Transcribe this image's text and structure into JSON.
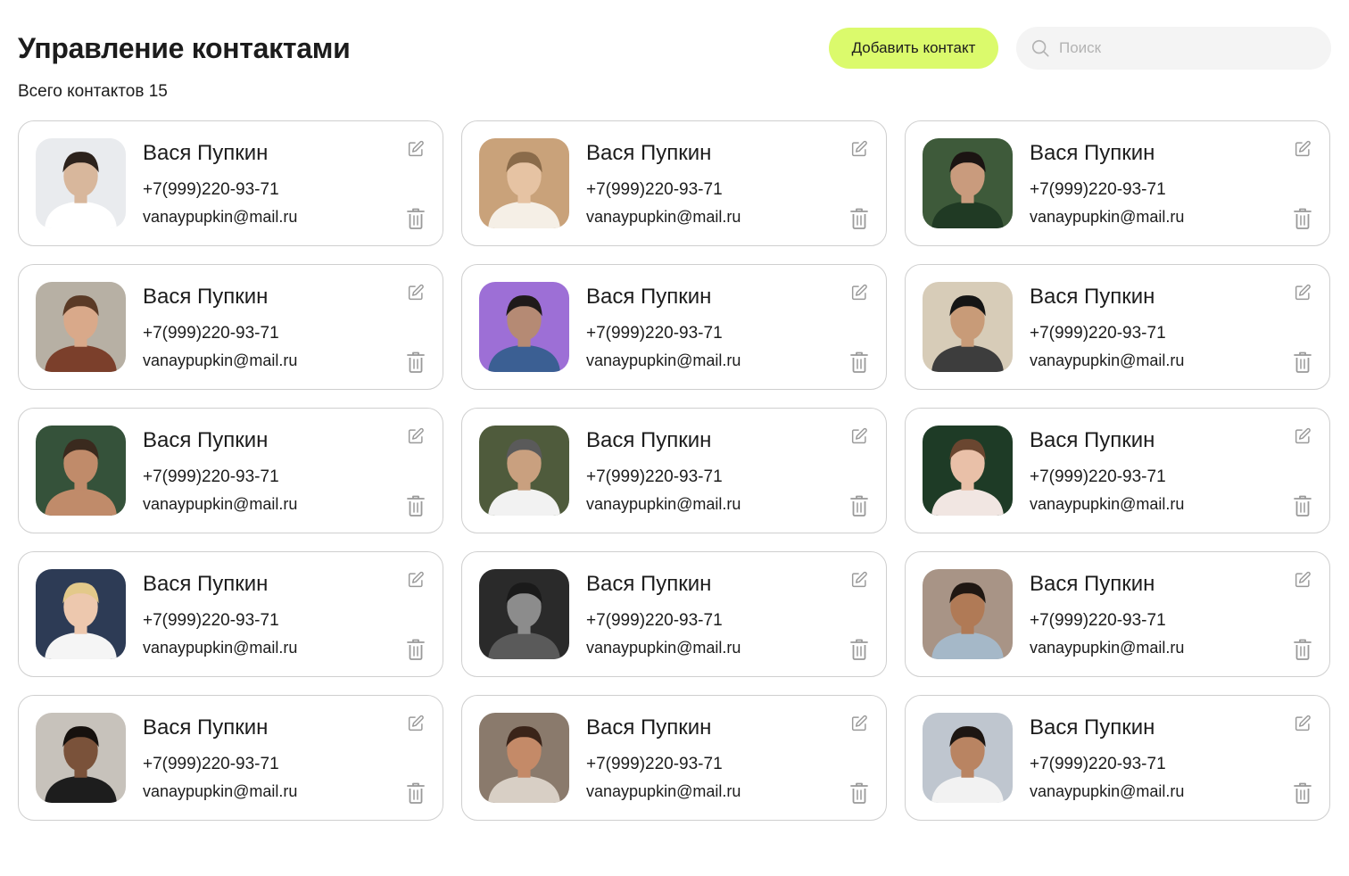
{
  "header": {
    "title": "Управление контактами",
    "add_button_label": "Добавить контакт",
    "search_placeholder": "Поиск",
    "search_value": ""
  },
  "summary": {
    "count_label": "Всего контактов",
    "count": "15"
  },
  "colors": {
    "accent": "#dbfa6c",
    "card_border": "#cfcfcf",
    "search_bg": "#f4f4f4",
    "icon": "#9a9a9a"
  },
  "icons": {
    "search": "search-icon",
    "edit": "edit-icon",
    "delete": "trash-icon"
  },
  "contacts": [
    {
      "name": "Вася Пупкин",
      "phone": "+7(999)220-93-71",
      "email": "vanaypupkin@mail.ru"
    },
    {
      "name": "Вася Пупкин",
      "phone": "+7(999)220-93-71",
      "email": "vanaypupkin@mail.ru"
    },
    {
      "name": "Вася Пупкин",
      "phone": "+7(999)220-93-71",
      "email": "vanaypupkin@mail.ru"
    },
    {
      "name": "Вася Пупкин",
      "phone": "+7(999)220-93-71",
      "email": "vanaypupkin@mail.ru"
    },
    {
      "name": "Вася Пупкин",
      "phone": "+7(999)220-93-71",
      "email": "vanaypupkin@mail.ru"
    },
    {
      "name": "Вася Пупкин",
      "phone": "+7(999)220-93-71",
      "email": "vanaypupkin@mail.ru"
    },
    {
      "name": "Вася Пупкин",
      "phone": "+7(999)220-93-71",
      "email": "vanaypupkin@mail.ru"
    },
    {
      "name": "Вася Пупкин",
      "phone": "+7(999)220-93-71",
      "email": "vanaypupkin@mail.ru"
    },
    {
      "name": "Вася Пупкин",
      "phone": "+7(999)220-93-71",
      "email": "vanaypupkin@mail.ru"
    },
    {
      "name": "Вася Пупкин",
      "phone": "+7(999)220-93-71",
      "email": "vanaypupkin@mail.ru"
    },
    {
      "name": "Вася Пупкин",
      "phone": "+7(999)220-93-71",
      "email": "vanaypupkin@mail.ru"
    },
    {
      "name": "Вася Пупкин",
      "phone": "+7(999)220-93-71",
      "email": "vanaypupkin@mail.ru"
    },
    {
      "name": "Вася Пупкин",
      "phone": "+7(999)220-93-71",
      "email": "vanaypupkin@mail.ru"
    },
    {
      "name": "Вася Пупкин",
      "phone": "+7(999)220-93-71",
      "email": "vanaypupkin@mail.ru"
    },
    {
      "name": "Вася Пупкин",
      "phone": "+7(999)220-93-71",
      "email": "vanaypupkin@mail.ru"
    }
  ]
}
